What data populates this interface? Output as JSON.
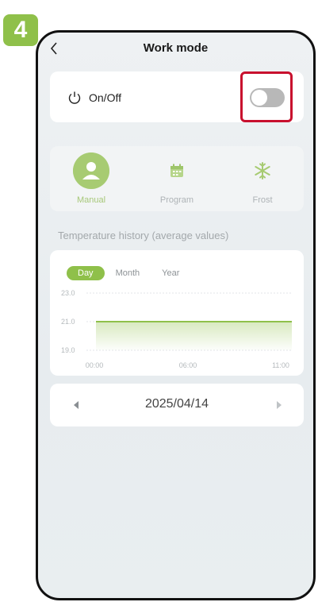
{
  "step_badge": "4",
  "header": {
    "title": "Work mode"
  },
  "onoff": {
    "label": "On/Off",
    "toggle_on": false
  },
  "modes": [
    {
      "label": "Manual",
      "icon": "person-icon",
      "active": true
    },
    {
      "label": "Program",
      "icon": "calendar-icon",
      "active": false
    },
    {
      "label": "Frost",
      "icon": "snowflake-icon",
      "active": false
    }
  ],
  "history_title": "Temperature history (average values)",
  "chart_tabs": [
    {
      "label": "Day",
      "active": true
    },
    {
      "label": "Month",
      "active": false
    },
    {
      "label": "Year",
      "active": false
    }
  ],
  "chart_data": {
    "type": "area",
    "title": "",
    "x": [
      "00:00",
      "11:00"
    ],
    "y": [
      21.0,
      21.0
    ],
    "x_ticks": [
      "00:00",
      "06:00",
      "11:00"
    ],
    "y_ticks": [
      "23.0",
      "21.0",
      "19.0"
    ],
    "ylim": [
      19.0,
      23.0
    ],
    "grid": true,
    "series_color": "#8fc04a"
  },
  "date_nav": {
    "date": "2025/04/14"
  },
  "colors": {
    "accent": "#8fc04a",
    "highlight": "#c8102e"
  }
}
